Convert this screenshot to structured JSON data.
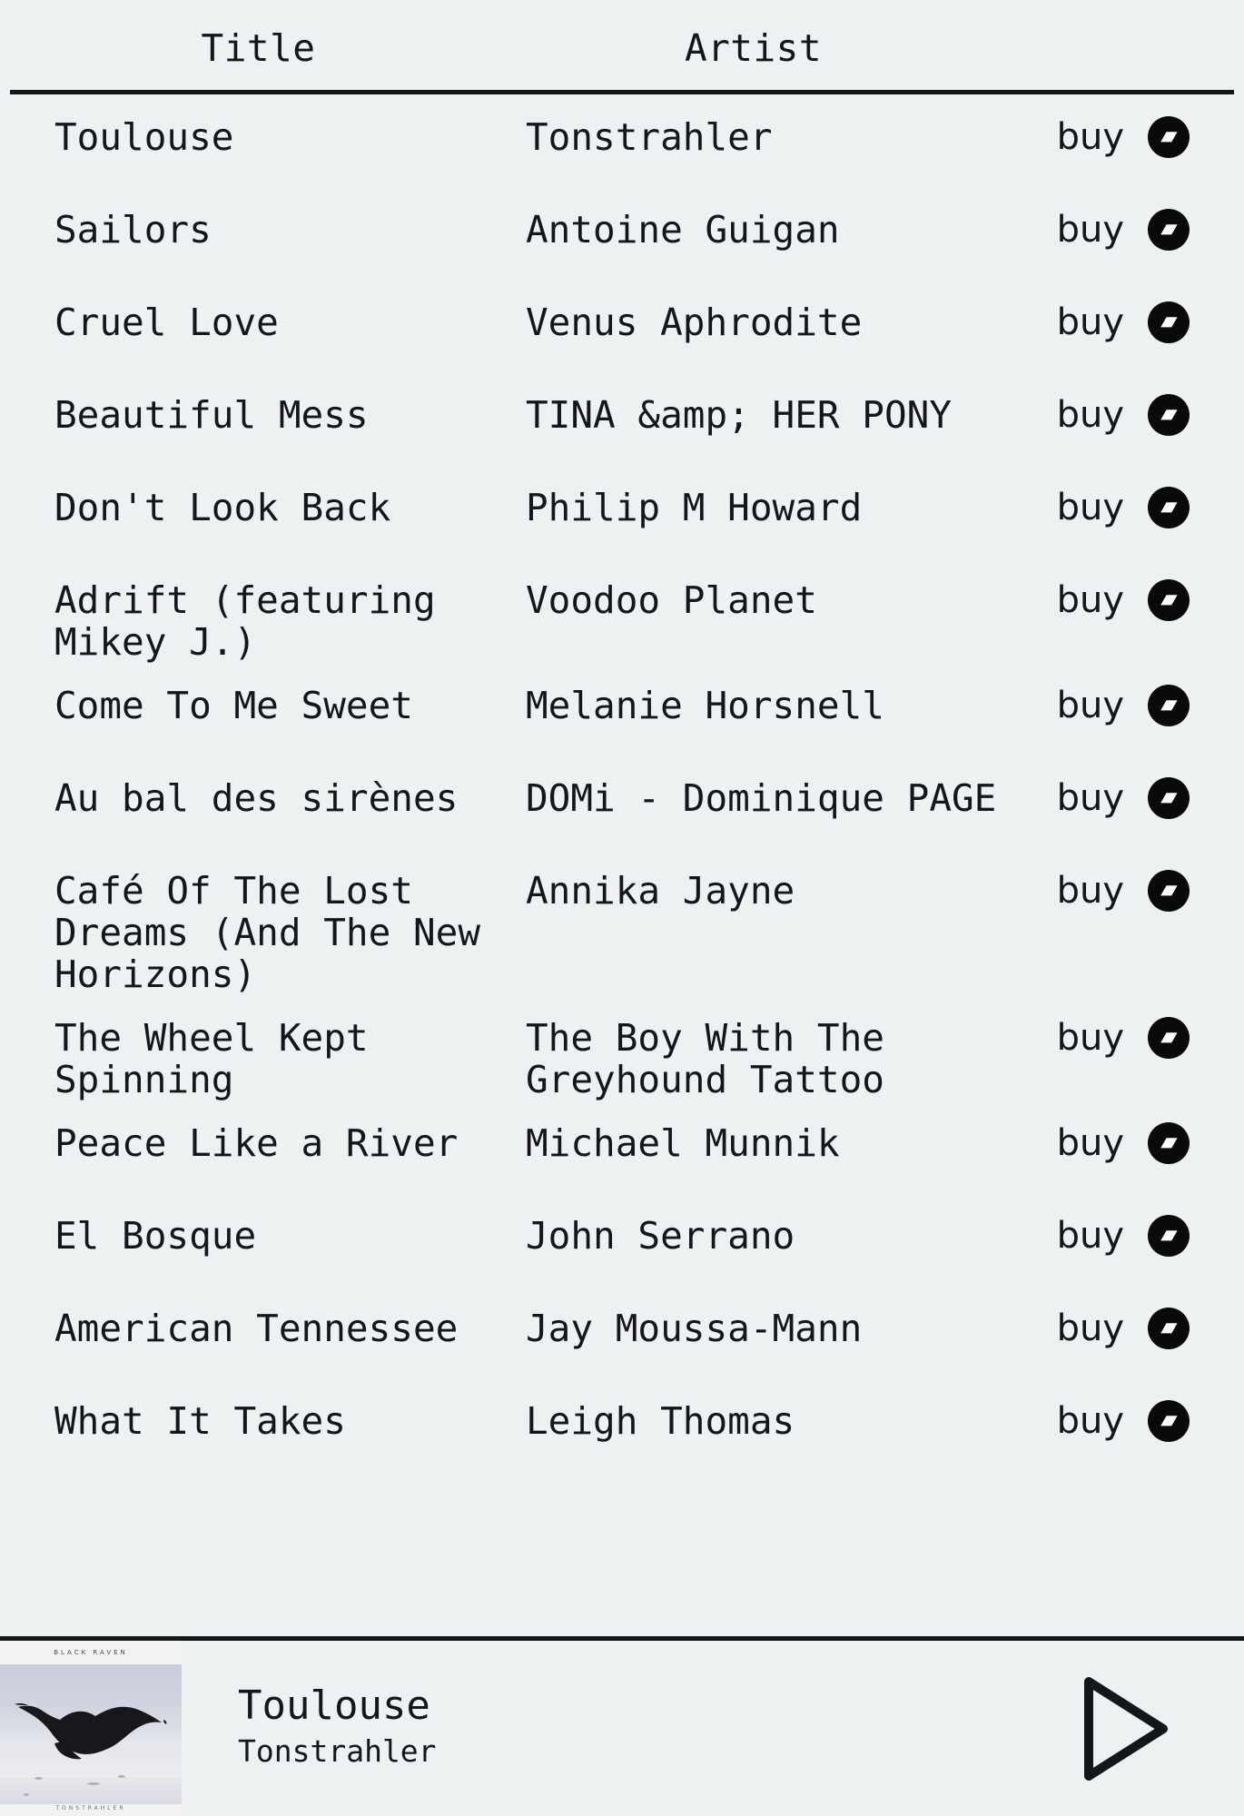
{
  "table": {
    "headers": {
      "title": "Title",
      "artist": "Artist"
    },
    "buy_label": "buy",
    "buy_icon": "bandcamp-icon",
    "rows": [
      {
        "title": "Toulouse",
        "artist": "Tonstrahler"
      },
      {
        "title": "Sailors",
        "artist": "Antoine Guigan"
      },
      {
        "title": "Cruel Love",
        "artist": "Venus Aphrodite"
      },
      {
        "title": "Beautiful Mess",
        "artist": "TINA &amp; HER PONY"
      },
      {
        "title": "Don't Look Back",
        "artist": "Philip M Howard"
      },
      {
        "title": "Adrift (featuring Mikey J.)",
        "artist": "Voodoo Planet"
      },
      {
        "title": "Come To Me Sweet",
        "artist": "Melanie Horsnell"
      },
      {
        "title": "Au bal des sirènes",
        "artist": "DOMi - Dominique PAGE"
      },
      {
        "title": "Café Of The Lost Dreams (And The New Horizons)",
        "artist": "Annika Jayne"
      },
      {
        "title": "The Wheel Kept Spinning",
        "artist": "The Boy With The Greyhound Tattoo"
      },
      {
        "title": "Peace Like a River",
        "artist": "Michael Munnik"
      },
      {
        "title": "El Bosque",
        "artist": "John Serrano"
      },
      {
        "title": "American Tennessee",
        "artist": "Jay Moussa-Mann"
      },
      {
        "title": "What It Takes",
        "artist": "Leigh Thomas"
      }
    ]
  },
  "player": {
    "now_playing_title": "Toulouse",
    "now_playing_artist": "Tonstrahler",
    "play_icon": "play-triangle-icon",
    "artwork": {
      "album_title": "BLACK RAVEN",
      "album_artist": "TONSTRAHLER",
      "description": "raven-in-flight-over-snow"
    }
  },
  "colors": {
    "background": "#eef1f2",
    "foreground": "#14171a",
    "rule": "#14171a",
    "icon_fill": "#0a0a0a"
  }
}
